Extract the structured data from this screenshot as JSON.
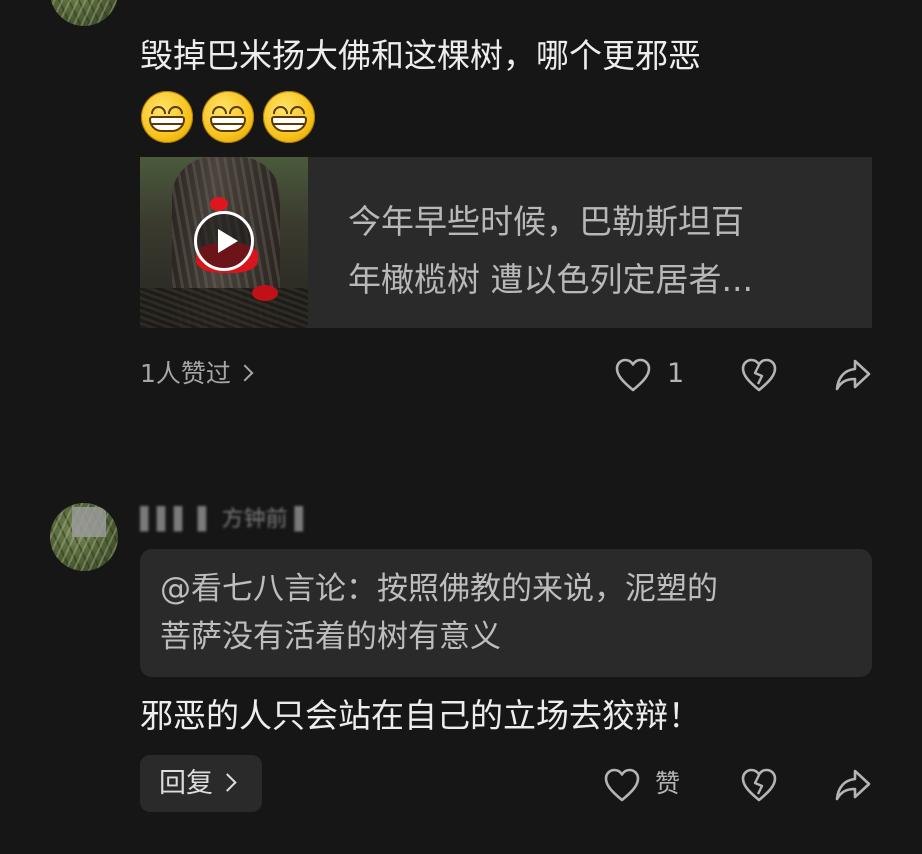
{
  "comment1": {
    "text": "毁掉巴米扬大佛和这棵树，哪个更邪恶",
    "emoji_count": 3,
    "video_card": {
      "line1": "今年早些时候，巴勒斯坦百",
      "line2": "年橄榄树 遭以色列定居者..."
    },
    "likes_summary": "1人赞过",
    "like_count": "1"
  },
  "comment2": {
    "username": "▌▌▌ ▌ 方钟前 ▌",
    "quote_line1": "@看七八言论：按照佛教的来说，泥塑的",
    "quote_line2": "菩萨没有活着的树有意义",
    "text": "邪恶的人只会站在自己的立场去狡辩！",
    "reply_label": "回复",
    "like_label": "赞"
  },
  "colors": {
    "background": "#161616",
    "card": "#2a2a2a",
    "text_primary": "#ededed",
    "text_secondary": "#b8b8b8"
  },
  "icons": [
    "heart-icon",
    "broken-heart-icon",
    "share-icon",
    "play-icon",
    "chevron-right-icon",
    "grin-emoji-icon"
  ]
}
